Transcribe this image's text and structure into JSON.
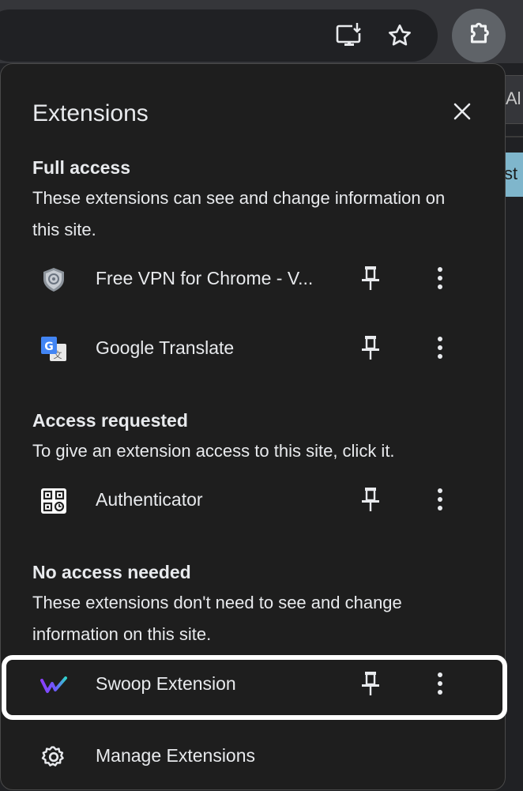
{
  "toolbar": {
    "install_icon": "install-app-icon",
    "bookmark_icon": "star-icon",
    "extensions_icon": "puzzle-icon",
    "edge_tab_text": "Al",
    "edge_button_text": "st"
  },
  "panel": {
    "title": "Extensions",
    "close_icon": "close-icon",
    "sections": {
      "full_access": {
        "heading": "Full access",
        "description": "These extensions can see and change information on this site."
      },
      "access_requested": {
        "heading": "Access requested",
        "description": "To give an extension access to this site, click it."
      },
      "no_access": {
        "heading": "No access needed",
        "description": "These extensions don't need to see and change information on this site."
      }
    },
    "extensions": {
      "vpn": {
        "name": "Free VPN for Chrome - V...",
        "icon": "shield-icon"
      },
      "translate": {
        "name": "Google Translate",
        "icon": "translate-icon"
      },
      "authenticator": {
        "name": "Authenticator",
        "icon": "qr-code-icon"
      },
      "swoop": {
        "name": "Swoop Extension",
        "icon": "swoop-logo-icon"
      }
    },
    "manage": {
      "label": "Manage Extensions",
      "icon": "gear-icon"
    }
  },
  "colors": {
    "panel_bg": "#1e1e1e",
    "text": "#e8eaed",
    "highlight": "#ffffff",
    "toolbar_bg": "#35363a"
  }
}
